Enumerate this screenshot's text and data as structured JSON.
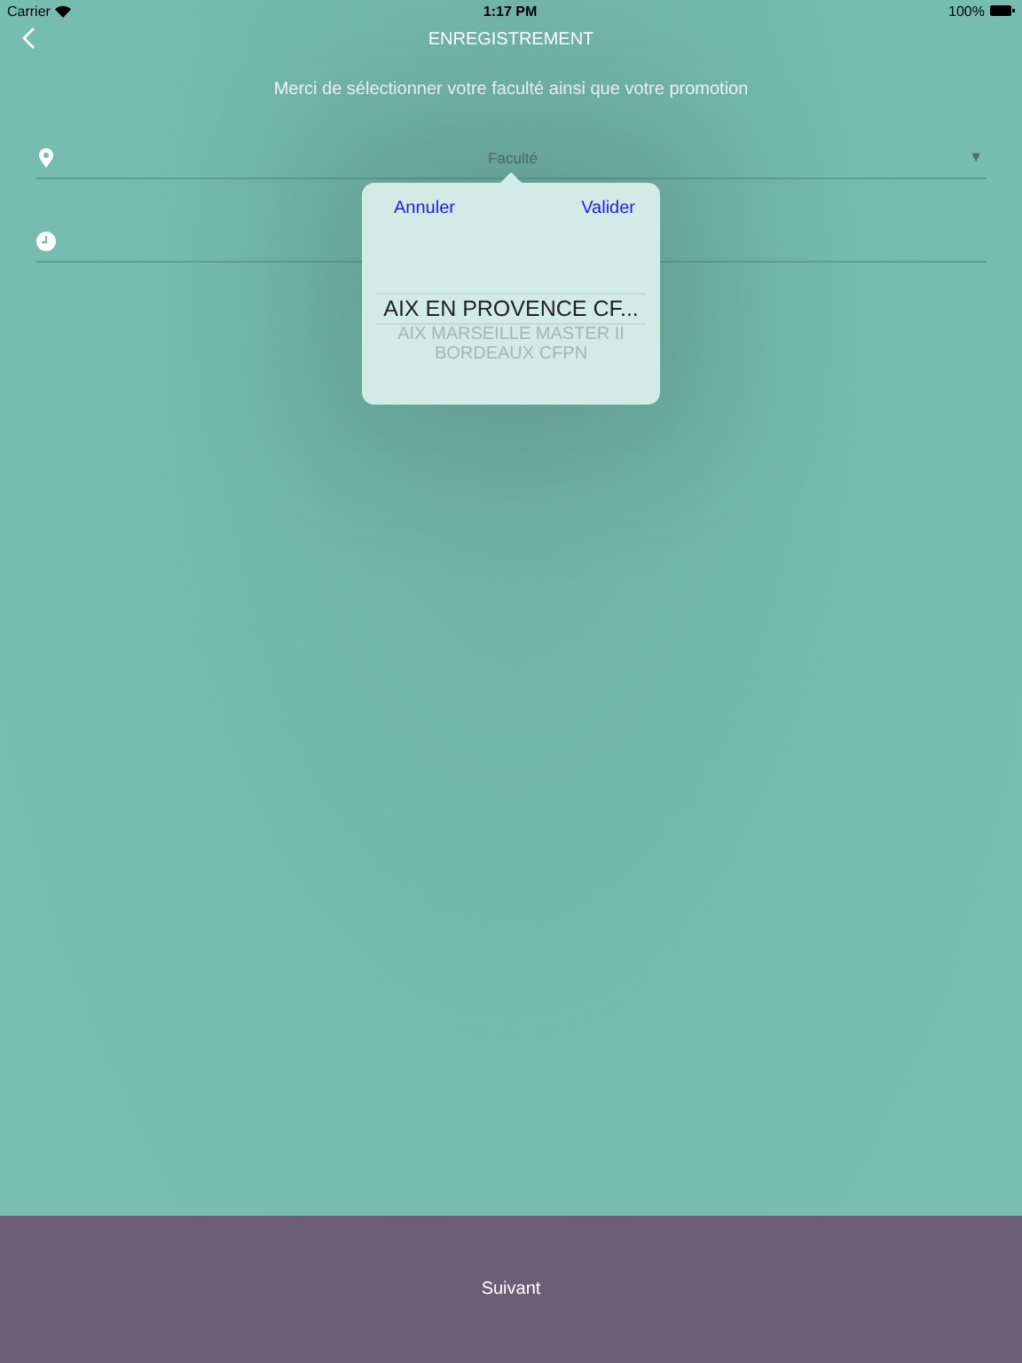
{
  "status_bar": {
    "carrier": "Carrier",
    "time": "1:17 PM",
    "battery": "100%"
  },
  "nav": {
    "title": "ENREGISTREMENT"
  },
  "subtitle": "Merci de sélectionner votre faculté ainsi que votre promotion",
  "fields": [
    {
      "kind": "location",
      "placeholder": "Faculté",
      "dropdown_icon": "▼"
    },
    {
      "kind": "clock"
    }
  ],
  "picker": {
    "cancel": "Annuler",
    "confirm": "Valider",
    "options": [
      {
        "label": "AIX EN PROVENCE CF...",
        "selected": true
      },
      {
        "label": "AIX MARSEILLE MASTER II",
        "selected": false
      },
      {
        "label": "BORDEAUX CFPN",
        "selected": false
      }
    ]
  },
  "footer": {
    "button": "Suivant"
  }
}
